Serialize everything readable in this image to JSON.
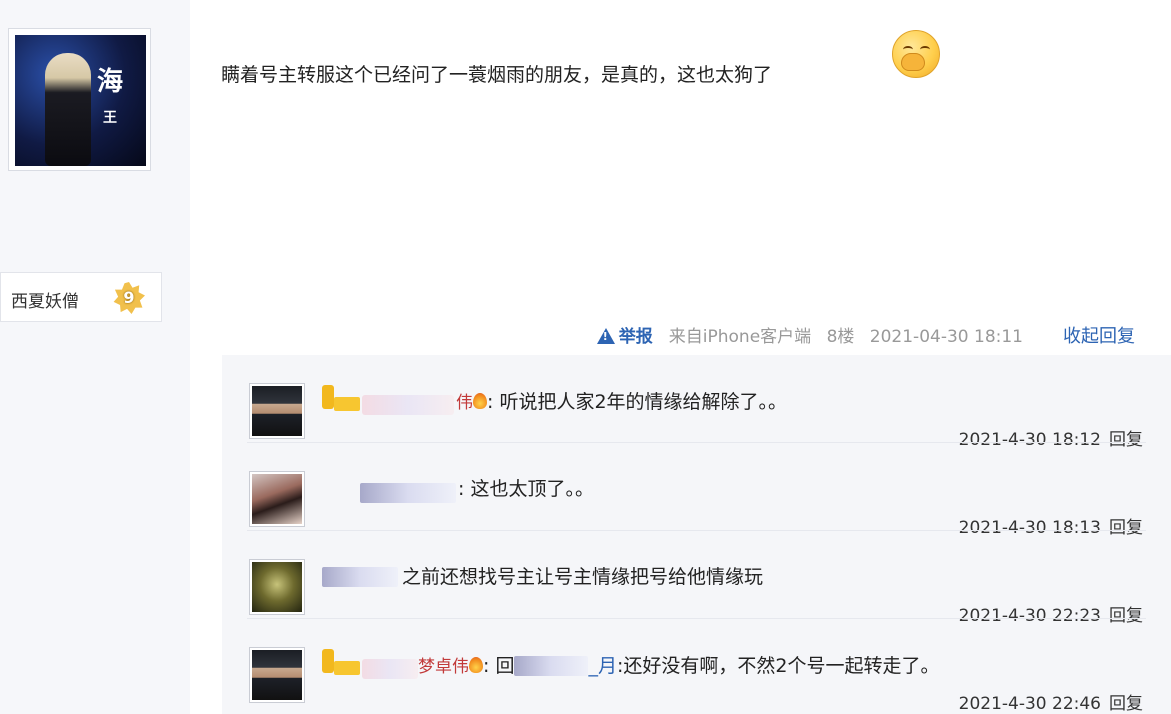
{
  "post": {
    "author": "西夏妖僧",
    "avatar_text": "海",
    "avatar_text2": "王",
    "level": "9",
    "text": "瞒着号主转服这个已经问了一蓑烟雨的朋友，是真的，这也太狗了",
    "emoji": "捂嘴笑-emoji-icon",
    "meta": {
      "report": "举报",
      "from": "来自iPhone客户端",
      "floor": "8楼",
      "time": "2021-04-30 18:11",
      "collapse": "收起回复"
    }
  },
  "replies": [
    {
      "name": "伟",
      "text": ": 听说把人家2年的情缘给解除了。。",
      "time": "2021-4-30 18:12",
      "reply_label": "回复"
    },
    {
      "name": "",
      "text": ": 这也太顶了。。",
      "time": "2021-4-30 18:13",
      "reply_label": "回复"
    },
    {
      "name": "",
      "text": "之前还想找号主让号主情缘把号给他情缘玩",
      "time": "2021-4-30 22:23",
      "reply_label": "回复"
    },
    {
      "name": "梦卓伟",
      "prefix": ": 回",
      "mention_tail": "_月",
      "text": ":还好没有啊，不然2个号一起转走了。",
      "time": "2021-4-30 22:46",
      "reply_label": "回复"
    }
  ],
  "colors": {
    "link": "#2d64b3",
    "reply_bg": "#f5f6f9",
    "name_red": "#c23a3a",
    "vip_gold": "#f2b81e"
  }
}
